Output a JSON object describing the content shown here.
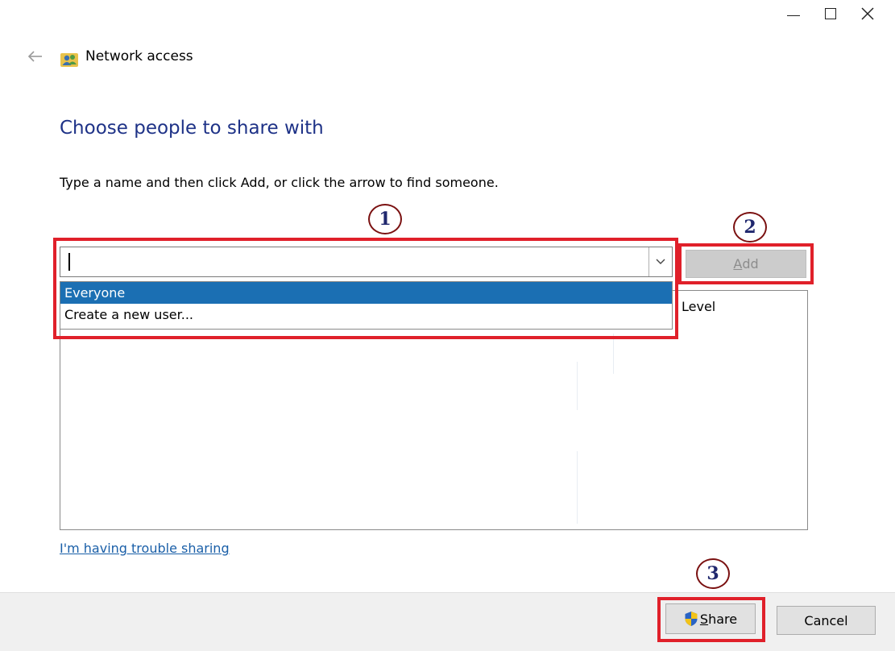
{
  "window": {
    "title": "Network access",
    "controls": [
      "minimize",
      "maximize",
      "close"
    ],
    "icons": {
      "back": "back-arrow-icon",
      "title": "network-users-icon",
      "combo_arrow": "chevron-down-icon",
      "share": "uac-shield-icon"
    }
  },
  "main": {
    "heading": "Choose people to share with",
    "instructions": "Type a name and then click Add, or click the arrow to find someone.",
    "name_input": {
      "value": "",
      "placeholder": ""
    },
    "dropdown_options": [
      {
        "label": "Everyone",
        "selected": true
      },
      {
        "label": "Create a new user...",
        "selected": false
      }
    ],
    "add_button": {
      "prefix": "",
      "access_key": "A",
      "rest": "dd",
      "enabled": false
    },
    "list": {
      "visible_column_header": "Level"
    },
    "trouble_link": "I'm having trouble sharing"
  },
  "footer": {
    "share_button": {
      "prefix": "",
      "access_key": "S",
      "rest": "hare"
    },
    "cancel_button": "Cancel"
  },
  "annotations": {
    "markers": [
      "1",
      "2",
      "3"
    ],
    "highlight_color": "#e0202a",
    "marker_text_color": "#20286e",
    "marker_ring_color": "#7a1010"
  },
  "colors": {
    "heading": "#1e3287",
    "link": "#1a5fa8",
    "selection": "#1b6fb3",
    "footer_bg": "#f0f0f0"
  }
}
